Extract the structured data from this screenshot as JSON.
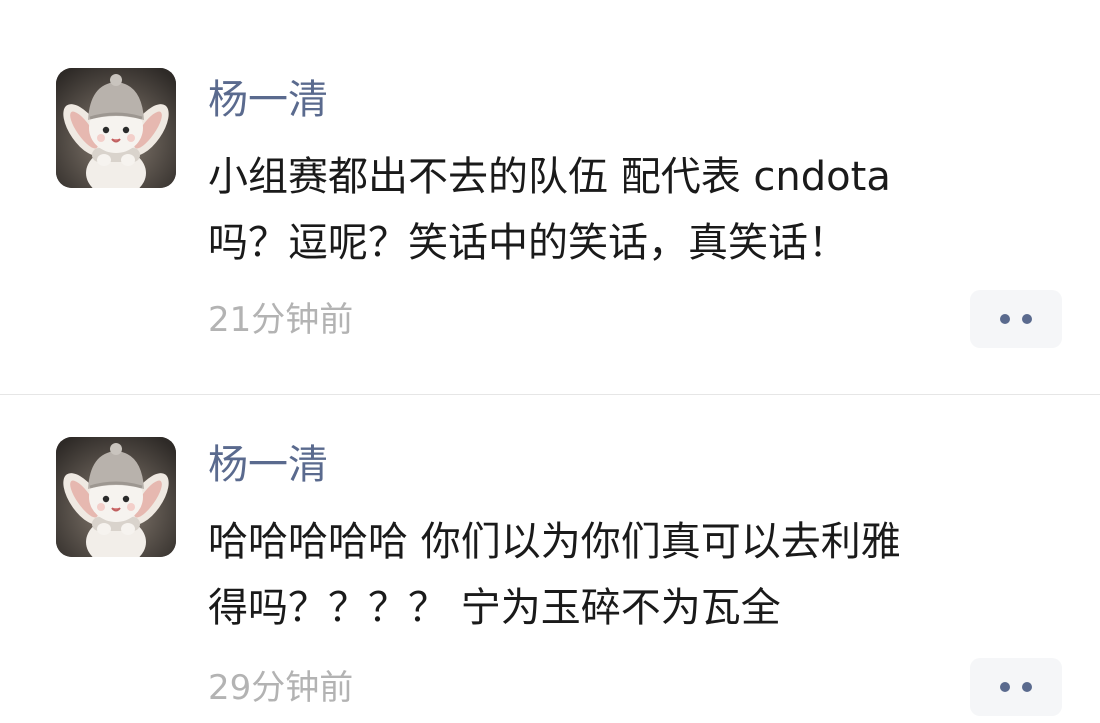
{
  "comments": [
    {
      "username": "杨一清",
      "avatar_icon": "rabbit-avatar-icon",
      "lines": [
        "小组赛都出不去的队伍 配代表 cndota",
        "吗？逗呢？笑话中的笑话，真笑话！"
      ],
      "time": "21分钟前",
      "more_icon": "more-dots-icon"
    },
    {
      "username": "杨一清",
      "avatar_icon": "rabbit-avatar-icon",
      "lines": [
        "哈哈哈哈哈 你们以为你们真可以去利雅",
        "得吗？？？？  宁为玉碎不为瓦全"
      ],
      "time": "29分钟前",
      "more_icon": "more-dots-icon"
    }
  ],
  "colors": {
    "username": "#5a6a8e",
    "body_text": "#1a1a1a",
    "timestamp": "#b3b3b3",
    "more_button_bg": "#f5f6f8",
    "divider": "#e6e6e6"
  }
}
